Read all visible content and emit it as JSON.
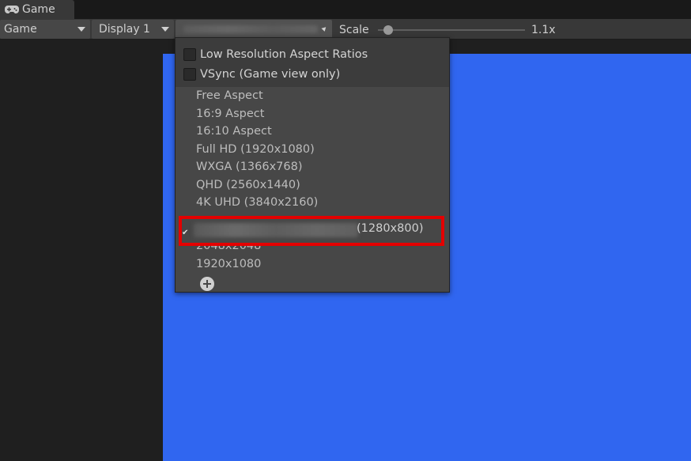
{
  "tab": {
    "label": "Game",
    "icon": "gamepad-icon"
  },
  "toolbar": {
    "view_dropdown": "Game",
    "display_dropdown": "Display 1",
    "scale_label": "Scale",
    "scale_value": "1.1x",
    "scale_level": 0.07
  },
  "viewport": {
    "background": "#3066f0"
  },
  "resolution_menu": {
    "checkboxes": [
      {
        "label": "Low Resolution Aspect Ratios",
        "checked": false
      },
      {
        "label": "VSync (Game view only)",
        "checked": false
      }
    ],
    "options": [
      "Free Aspect",
      "16:9 Aspect",
      "16:10 Aspect",
      "Full HD (1920x1080)",
      "WXGA (1366x768)",
      "QHD (2560x1440)",
      "4K UHD (3840x2160)"
    ],
    "selected_suffix": "(1280x800)",
    "custom_options": [
      "2048x2048",
      "1920x1080"
    ],
    "highlight_color": "#e40000"
  }
}
